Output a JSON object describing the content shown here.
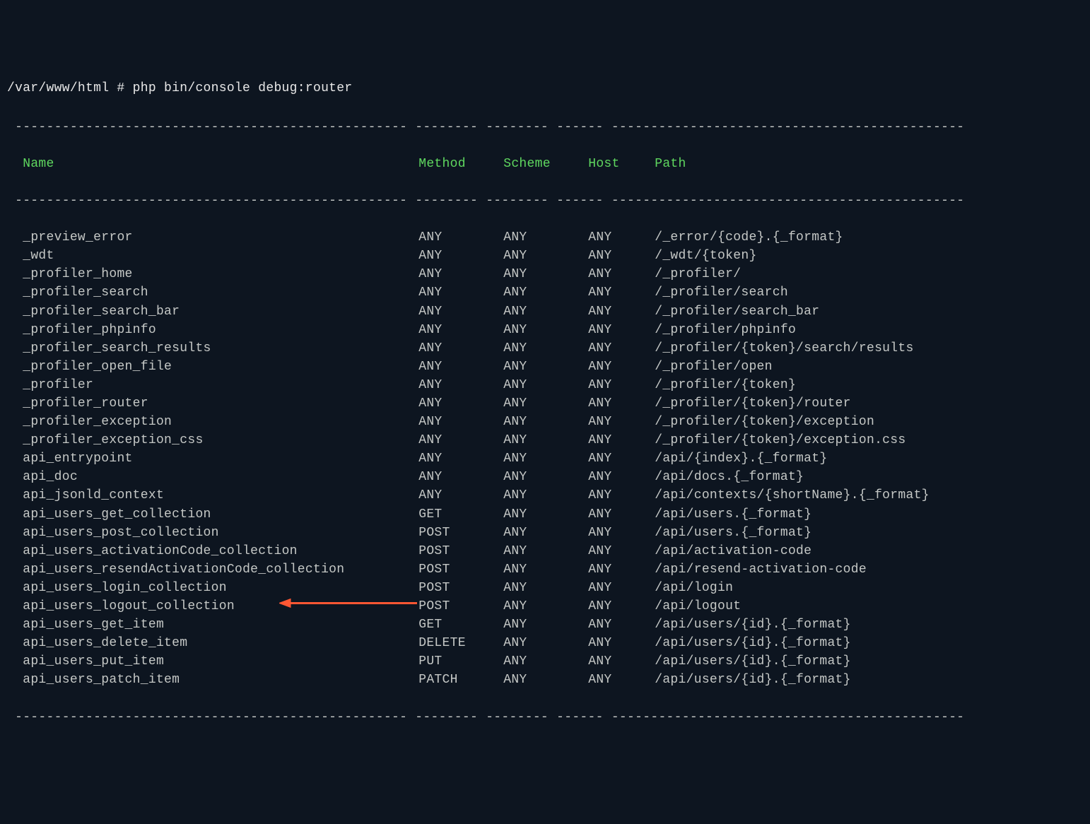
{
  "prompt": "/var/www/html # php bin/console debug:router",
  "divider_top": " -------------------------------------------------- -------- -------- ------ --------------------------------------------- ",
  "divider_mid": " -------------------------------------------------- -------- -------- ------ --------------------------------------------- ",
  "divider_bottom": " -------------------------------------------------- -------- -------- ------ --------------------------------------------- ",
  "headers": {
    "name": "Name",
    "method": "Method",
    "scheme": "Scheme",
    "host": "Host",
    "path": "Path"
  },
  "routes": [
    {
      "name": "_preview_error",
      "method": "ANY",
      "scheme": "ANY",
      "host": "ANY",
      "path": "/_error/{code}.{_format}",
      "highlight": false
    },
    {
      "name": "_wdt",
      "method": "ANY",
      "scheme": "ANY",
      "host": "ANY",
      "path": "/_wdt/{token}",
      "highlight": false
    },
    {
      "name": "_profiler_home",
      "method": "ANY",
      "scheme": "ANY",
      "host": "ANY",
      "path": "/_profiler/",
      "highlight": false
    },
    {
      "name": "_profiler_search",
      "method": "ANY",
      "scheme": "ANY",
      "host": "ANY",
      "path": "/_profiler/search",
      "highlight": false
    },
    {
      "name": "_profiler_search_bar",
      "method": "ANY",
      "scheme": "ANY",
      "host": "ANY",
      "path": "/_profiler/search_bar",
      "highlight": false
    },
    {
      "name": "_profiler_phpinfo",
      "method": "ANY",
      "scheme": "ANY",
      "host": "ANY",
      "path": "/_profiler/phpinfo",
      "highlight": false
    },
    {
      "name": "_profiler_search_results",
      "method": "ANY",
      "scheme": "ANY",
      "host": "ANY",
      "path": "/_profiler/{token}/search/results",
      "highlight": false
    },
    {
      "name": "_profiler_open_file",
      "method": "ANY",
      "scheme": "ANY",
      "host": "ANY",
      "path": "/_profiler/open",
      "highlight": false
    },
    {
      "name": "_profiler",
      "method": "ANY",
      "scheme": "ANY",
      "host": "ANY",
      "path": "/_profiler/{token}",
      "highlight": false
    },
    {
      "name": "_profiler_router",
      "method": "ANY",
      "scheme": "ANY",
      "host": "ANY",
      "path": "/_profiler/{token}/router",
      "highlight": false
    },
    {
      "name": "_profiler_exception",
      "method": "ANY",
      "scheme": "ANY",
      "host": "ANY",
      "path": "/_profiler/{token}/exception",
      "highlight": false
    },
    {
      "name": "_profiler_exception_css",
      "method": "ANY",
      "scheme": "ANY",
      "host": "ANY",
      "path": "/_profiler/{token}/exception.css",
      "highlight": false
    },
    {
      "name": "api_entrypoint",
      "method": "ANY",
      "scheme": "ANY",
      "host": "ANY",
      "path": "/api/{index}.{_format}",
      "highlight": false
    },
    {
      "name": "api_doc",
      "method": "ANY",
      "scheme": "ANY",
      "host": "ANY",
      "path": "/api/docs.{_format}",
      "highlight": false
    },
    {
      "name": "api_jsonld_context",
      "method": "ANY",
      "scheme": "ANY",
      "host": "ANY",
      "path": "/api/contexts/{shortName}.{_format}",
      "highlight": false
    },
    {
      "name": "api_users_get_collection",
      "method": "GET",
      "scheme": "ANY",
      "host": "ANY",
      "path": "/api/users.{_format}",
      "highlight": false
    },
    {
      "name": "api_users_post_collection",
      "method": "POST",
      "scheme": "ANY",
      "host": "ANY",
      "path": "/api/users.{_format}",
      "highlight": false
    },
    {
      "name": "api_users_activationCode_collection",
      "method": "POST",
      "scheme": "ANY",
      "host": "ANY",
      "path": "/api/activation-code",
      "highlight": false
    },
    {
      "name": "api_users_resendActivationCode_collection",
      "method": "POST",
      "scheme": "ANY",
      "host": "ANY",
      "path": "/api/resend-activation-code",
      "highlight": false
    },
    {
      "name": "api_users_login_collection",
      "method": "POST",
      "scheme": "ANY",
      "host": "ANY",
      "path": "/api/login",
      "highlight": false
    },
    {
      "name": "api_users_logout_collection",
      "method": "POST",
      "scheme": "ANY",
      "host": "ANY",
      "path": "/api/logout",
      "highlight": true
    },
    {
      "name": "api_users_get_item",
      "method": "GET",
      "scheme": "ANY",
      "host": "ANY",
      "path": "/api/users/{id}.{_format}",
      "highlight": false
    },
    {
      "name": "api_users_delete_item",
      "method": "DELETE",
      "scheme": "ANY",
      "host": "ANY",
      "path": "/api/users/{id}.{_format}",
      "highlight": false
    },
    {
      "name": "api_users_put_item",
      "method": "PUT",
      "scheme": "ANY",
      "host": "ANY",
      "path": "/api/users/{id}.{_format}",
      "highlight": false
    },
    {
      "name": "api_users_patch_item",
      "method": "PATCH",
      "scheme": "ANY",
      "host": "ANY",
      "path": "/api/users/{id}.{_format}",
      "highlight": false
    }
  ]
}
